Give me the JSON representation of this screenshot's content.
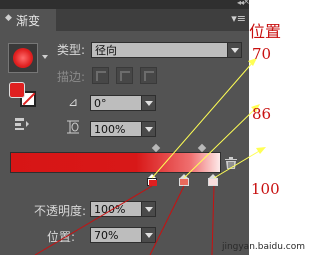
{
  "panel": {
    "tab_title": "渐变",
    "type_label": "类型:",
    "type_value": "径向",
    "stroke_label": "描边:",
    "angle_value": "0°",
    "aspect_value": "100%",
    "opacity_label": "不透明度:",
    "opacity_value": "100%",
    "location_label": "位置:",
    "location_value": "70%"
  },
  "gradient": {
    "colors": [
      "#d71515",
      "#f07070",
      "#fdeaea"
    ],
    "stops": [
      {
        "color": "#e02020",
        "location": 70
      },
      {
        "color": "#e86a5c",
        "location": 86
      },
      {
        "color": "#f9dcdc",
        "location": 100
      }
    ]
  },
  "annotations": {
    "title": "位置",
    "label_70": "70",
    "label_86": "86",
    "label_100": "100"
  },
  "watermark": "jingyan.baidu.com",
  "colors": {
    "panel_bg": "#535353",
    "annotation_red": "#c81010",
    "arrow_yellow": "#ffff55"
  }
}
